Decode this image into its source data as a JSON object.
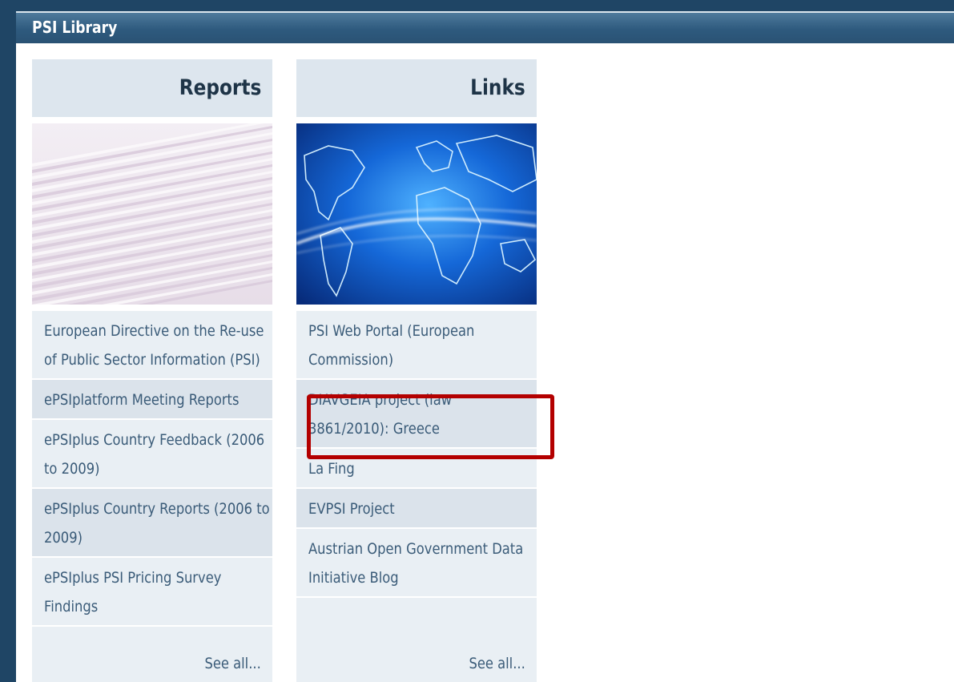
{
  "titlebar": {
    "title": "PSI Library"
  },
  "reports": {
    "heading": "Reports",
    "image": "stacked-paper-photo",
    "items": [
      "European Directive on the Re-use of Public Sector Information (PSI)",
      "ePSIplatform Meeting Reports",
      "ePSIplus Country Feedback (2006 to 2009)",
      "ePSIplus Country Reports (2006 to 2009)",
      "ePSIplus PSI Pricing Survey Findings"
    ],
    "see_all": "See all..."
  },
  "links": {
    "heading": "Links",
    "image": "glowing-world-map-photo",
    "items": [
      "PSI Web Portal (European Commission)",
      "DIAVGEIA project (law 3861/2010): Greece",
      "La Fing",
      "EVPSI Project",
      "Austrian Open Government Data Initiative Blog"
    ],
    "see_all": "See all..."
  },
  "colors": {
    "frame": "#1f4565",
    "titlebar": "#2e5a7e",
    "link_text": "#3a5b78",
    "highlight": "#b30000"
  }
}
